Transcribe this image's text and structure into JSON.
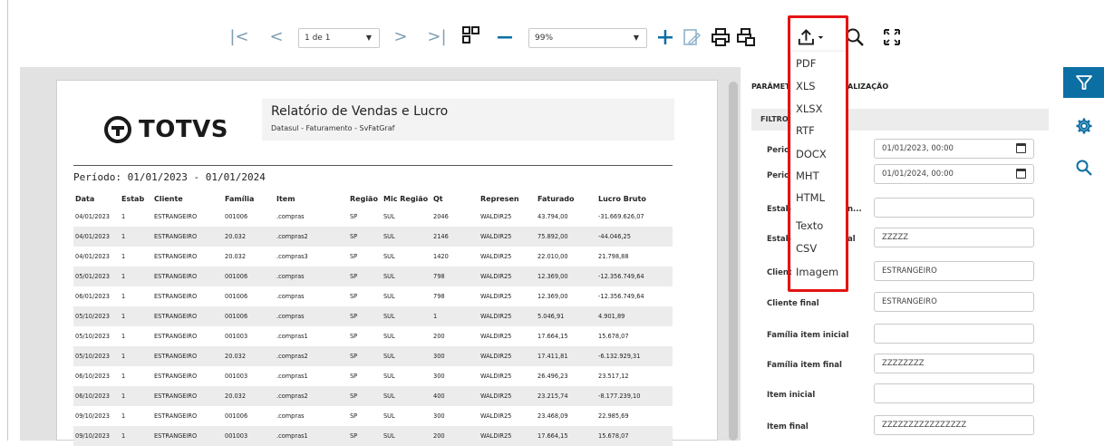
{
  "toolbar": {
    "first_icon": "first-page-icon",
    "prev_icon": "previous-page-icon",
    "page_value": "1 de 1",
    "next_icon": "next-page-icon",
    "last_icon": "last-page-icon",
    "zoom_value": "99%",
    "accent_color": "#0b6fa3"
  },
  "report": {
    "logo_text": "TOTVS",
    "title": "Relatório de Vendas e Lucro",
    "subtitle": "Datasul - Faturamento - SvFatGraf",
    "period": "Período: 01/01/2023 - 01/01/2024",
    "columns": [
      "Data",
      "Estab",
      "Cliente",
      "Família",
      "Item",
      "Região",
      "Mic Região",
      "Qt",
      "Represen",
      "Faturado",
      "Lucro Bruto"
    ],
    "rows": [
      [
        "04/01/2023",
        "1",
        "ESTRANGEIRO",
        "001006",
        ".compras",
        "SP",
        "SUL",
        "2046",
        "WALDIR25",
        "43.794,00",
        "-31.669.626,07"
      ],
      [
        "04/01/2023",
        "1",
        "ESTRANGEIRO",
        "20.032",
        ".compras2",
        "SP",
        "SUL",
        "2146",
        "WALDIR25",
        "75.892,00",
        "-44.046,25"
      ],
      [
        "04/01/2023",
        "1",
        "ESTRANGEIRO",
        "20.032",
        ".compras3",
        "SP",
        "SUL",
        "1420",
        "WALDIR25",
        "22.010,00",
        "21.798,88"
      ],
      [
        "05/01/2023",
        "1",
        "ESTRANGEIRO",
        "001006",
        ".compras",
        "SP",
        "SUL",
        "798",
        "WALDIR25",
        "12.369,00",
        "-12.356.749,64"
      ],
      [
        "06/01/2023",
        "1",
        "ESTRANGEIRO",
        "001006",
        ".compras",
        "SP",
        "SUL",
        "798",
        "WALDIR25",
        "12.369,00",
        "-12.356.749,64"
      ],
      [
        "05/10/2023",
        "1",
        "ESTRANGEIRO",
        "001006",
        ".compras",
        "SP",
        "SUL",
        "1",
        "WALDIR25",
        "5.046,91",
        "4.901,89"
      ],
      [
        "05/10/2023",
        "1",
        "ESTRANGEIRO",
        "001003",
        ".compras1",
        "SP",
        "SUL",
        "200",
        "WALDIR25",
        "17.664,15",
        "15.678,07"
      ],
      [
        "05/10/2023",
        "1",
        "ESTRANGEIRO",
        "20.032",
        ".compras2",
        "SP",
        "SUL",
        "300",
        "WALDIR25",
        "17.411,81",
        "-6.132.929,31"
      ],
      [
        "06/10/2023",
        "1",
        "ESTRANGEIRO",
        "001003",
        ".compras1",
        "SP",
        "SUL",
        "300",
        "WALDIR25",
        "26.496,23",
        "23.517,12"
      ],
      [
        "06/10/2023",
        "1",
        "ESTRANGEIRO",
        "20.032",
        ".compras2",
        "SP",
        "SUL",
        "400",
        "WALDIR25",
        "23.215,74",
        "-8.177.239,10"
      ],
      [
        "09/10/2023",
        "1",
        "ESTRANGEIRO",
        "001006",
        ".compras",
        "SP",
        "SUL",
        "300",
        "WALDIR25",
        "23.468,09",
        "22.985,69"
      ],
      [
        "09/10/2023",
        "1",
        "ESTRANGEIRO",
        "001003",
        ".compras1",
        "SP",
        "SUL",
        "200",
        "WALDIR25",
        "17.664,15",
        "15.678,07"
      ]
    ]
  },
  "export_menu": {
    "items": [
      "PDF",
      "XLS",
      "XLSX",
      "RTF",
      "DOCX",
      "MHT",
      "HTML",
      "Texto",
      "CSV",
      "Imagem"
    ],
    "highlight_color": "#e51313"
  },
  "panel": {
    "tab_params": "PARÂMET",
    "tab_viz": "ALIZAÇÃO",
    "filters_title": "FILTRO",
    "fields": [
      {
        "label": "Perio",
        "value": "01/01/2023, 00:00",
        "calendar": true
      },
      {
        "label": "Perio",
        "value": "01/01/2024, 00:00",
        "calendar": true
      },
      {
        "label": "Estab",
        "label2": "n...",
        "value": ""
      },
      {
        "label": "Estab",
        "label2": "al",
        "value": "ZZZZZ"
      },
      {
        "label": "Client",
        "value": "ESTRANGEIRO"
      },
      {
        "label": "Cliente final",
        "value": "ESTRANGEIRO"
      },
      {
        "label": "Família item inicial",
        "value": ""
      },
      {
        "label": "Família item final",
        "value": "ZZZZZZZZ"
      },
      {
        "label": "Item inicial",
        "value": ""
      },
      {
        "label": "Item final",
        "value": "ZZZZZZZZZZZZZZZZ"
      }
    ]
  },
  "rail": {
    "filter_icon": "filter-icon",
    "settings_icon": "settings-icon",
    "search_icon": "search-icon"
  }
}
